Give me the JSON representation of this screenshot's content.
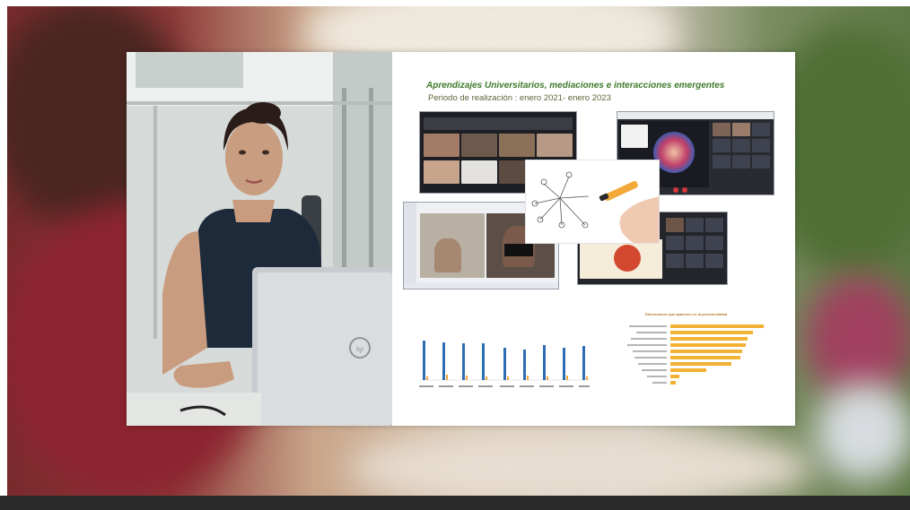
{
  "slide": {
    "title": "Aprendizajes Universitarios, mediaciones e interacciones emergentes",
    "subtitle": "Periodo de realización : enero 2021- enero 2023"
  },
  "charts": {
    "left_title": "",
    "right_title": "Dimensiones que aparecen en la presencialidad"
  },
  "colors": {
    "slide_title": "#3f7a2c",
    "bar_blue": "#2e6db4",
    "bar_orange": "#f2a33a",
    "bottom_bar": "#2b2b2b"
  },
  "icons": [
    "laptop-logo-icon",
    "marker-icon"
  ]
}
